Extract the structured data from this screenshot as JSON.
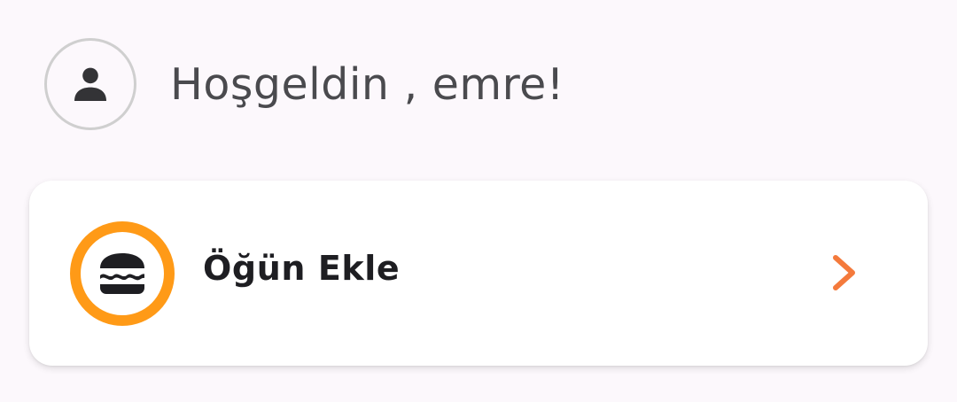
{
  "header": {
    "greeting": "Hoşgeldin , emre!",
    "avatar_icon": "person-icon"
  },
  "card": {
    "label": "Öğün Ekle",
    "icon": "burger-icon",
    "chevron_icon": "chevron-right-icon"
  },
  "colors": {
    "accent_orange": "#ff9a17",
    "chevron_orange": "#f47a3c",
    "background": "#fcf8fc",
    "text_dark": "#1e1e22",
    "text_greeting": "#4a4a4e",
    "avatar_border": "#cfcfcf"
  }
}
